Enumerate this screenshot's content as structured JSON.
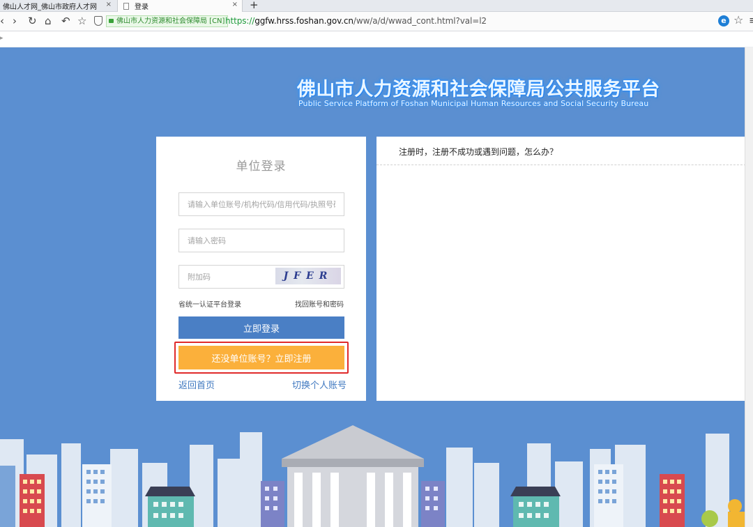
{
  "browser": {
    "tabs": [
      {
        "title": "佛山人才网_佛山市政府人才网",
        "active": false
      },
      {
        "title": "登录",
        "active": true
      }
    ],
    "new_tab": "+",
    "close_glyph": "×",
    "site_badge": "佛山市人力资源和社会保障局 [CN]",
    "url": {
      "scheme": "https://",
      "host": "ggfw.hrss.foshan.gov.cn",
      "path": "/ww/a/d/wwad_cont.html?val=l2"
    },
    "ie_label": "e",
    "icons": [
      "back-icon",
      "forward-icon",
      "reload-icon",
      "home-icon",
      "undo-icon",
      "star-icon",
      "shield-icon",
      "ie-icon",
      "favorite-icon",
      "menu-icon"
    ]
  },
  "header": {
    "title_cn": "佛山市人力资源和社会保障局公共服务平台",
    "title_en": "Public Service Platform of Foshan Municipal Human Resources and Social Security Bureau"
  },
  "login": {
    "title": "单位登录",
    "account_placeholder": "请输入单位账号/机构代码/信用代码/执照号码",
    "password_placeholder": "请输入密码",
    "captcha_placeholder": "附加码",
    "captcha_text": "JFER",
    "unified_login": "省统一认证平台登录",
    "recover": "找回账号和密码",
    "login_button": "立即登录",
    "register_button": "还没单位账号？立即注册",
    "back_home": "返回首页",
    "switch_personal": "切换个人账号"
  },
  "info": {
    "question": "注册时，注册不成功或遇到问题，怎么办？"
  },
  "colors": {
    "page_bg": "#5b8fd1",
    "login_button": "#4a7fc5",
    "register_button": "#fbb03b",
    "highlight": "#e02a2a",
    "link": "#3f78c0"
  }
}
